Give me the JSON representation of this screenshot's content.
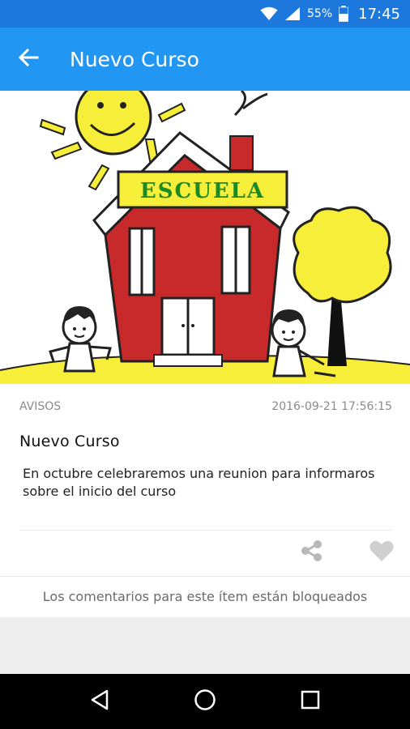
{
  "status_bar": {
    "battery_percent": "55%",
    "time": "17:45",
    "icons": [
      "wifi-icon",
      "signal-icon",
      "battery-icon"
    ]
  },
  "app_bar": {
    "title": "Nuevo Curso",
    "back_icon": "arrow-left-icon",
    "background": "#2196f3"
  },
  "hero": {
    "sign_text": "ESCUELA"
  },
  "post": {
    "category": "AVISOS",
    "timestamp": "2016-09-21 17:56:15",
    "title": "Nuevo Curso",
    "body": "En octubre celebraremos una reunion para informaros sobre el inicio del curso"
  },
  "actions": {
    "share_icon": "share-icon",
    "like_icon": "heart-icon"
  },
  "comments": {
    "locked_message": "Los comentarios para este ítem están bloqueados"
  },
  "nav_bar": {
    "icons": [
      "back-triangle-icon",
      "home-circle-icon",
      "recents-square-icon"
    ]
  }
}
